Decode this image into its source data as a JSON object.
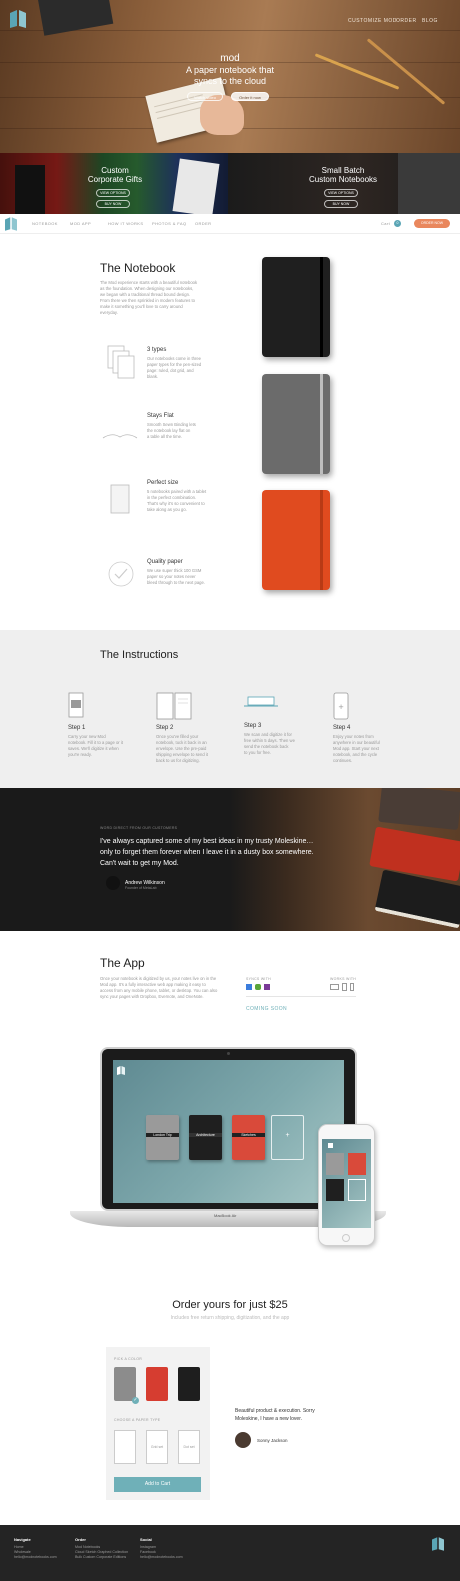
{
  "brand": {
    "logo_color": "#5aa5b5"
  },
  "hero": {
    "nav": [
      "CUSTOMIZE MOD",
      "ORDER",
      "BLOG"
    ],
    "title": "mod",
    "subtitle_line1": "A paper notebook that",
    "subtitle_line2": "syncs to the cloud",
    "watch_label": "Watch video",
    "order_label": "Order it now"
  },
  "promos": [
    {
      "title_line1": "Custom",
      "title_line2": "Corporate Gifts",
      "btn1": "VIEW OPTIONS",
      "btn2": "BUY NOW"
    },
    {
      "title_line1": "Small Batch",
      "title_line2": "Custom Notebooks",
      "btn1": "VIEW OPTIONS",
      "btn2": "BUY NOW"
    }
  ],
  "subnav": {
    "items": [
      "NOTEBOOK",
      "MOD APP",
      "HOW IT WORKS",
      "PHOTOS & FAQ",
      "ORDER"
    ],
    "cart_label": "Cart",
    "cart_count": "0",
    "order_label": "ORDER NOW"
  },
  "notebook": {
    "title": "The Notebook",
    "intro": [
      "The Mod experience starts with a beautiful notebook",
      "as the foundation. When designing our notebooks,",
      "we began with a traditional thread bound design.",
      "From there we then sprinkled in modern features to",
      "make it something you'll love to carry around",
      "everyday."
    ],
    "features": [
      {
        "title": "3 types",
        "desc": [
          "Our notebooks come in three",
          "paper types for the pen-sized",
          "page: ruled, dot grid, and",
          "blank."
        ]
      },
      {
        "title": "Stays Flat",
        "desc": [
          "Smooth Sewn Binding lets",
          "the notebook lay flat on",
          "a table all the time."
        ]
      },
      {
        "title": "Perfect size",
        "desc": [
          "5 notebooks paired with a tablet",
          "in the perfect combination.",
          "That's why it's so convenient to",
          "take along as you go."
        ]
      },
      {
        "title": "Quality paper",
        "desc": [
          "We use super thick 100 GSM",
          "paper so your notes never",
          "bleed through to the next page."
        ]
      }
    ]
  },
  "instructions": {
    "title": "The Instructions",
    "steps": [
      {
        "title": "Step 1",
        "desc": [
          "Carry your new Mod",
          "notebook. Fill it to a page or it",
          "saves. We'll digitize it when",
          "you're ready."
        ]
      },
      {
        "title": "Step 2",
        "desc": [
          "Once you've filled your",
          "notebook, tuck it back in an",
          "envelope. Use the pre-paid",
          "shipping envelope to send it",
          "back to us for digitizing."
        ]
      },
      {
        "title": "Step 3",
        "desc": [
          "We scan and digitize it for",
          "free within 5 days. Then we",
          "send the notebook back",
          "to you for free."
        ]
      },
      {
        "title": "Step 4",
        "desc": [
          "Enjoy your notes from",
          "anywhere in our beautiful",
          "Mod app. Start your next",
          "notebook, and the cycle",
          "continues."
        ]
      }
    ]
  },
  "testimonial": {
    "eyebrow": "WORD DIRECT FROM OUR CUSTOMERS",
    "quote": [
      "I've always captured some of my best ideas in my trusty Moleskine…",
      "only to forget them forever when I leave it in a dusty box somewhere.",
      "Can't wait to get my Mod."
    ],
    "author": "Andrew Wilkinson",
    "role": "Founder of MetaLab"
  },
  "app": {
    "title": "The App",
    "desc": [
      "Once your notebook is digitized by us, your notes live on in the",
      "Mod app. It's a fully interactive web app making it easy to",
      "access from any mobile phone, tablet, or desktop. You can also",
      "sync your pages with Dropbox, Evernote, and OneNote."
    ],
    "syncs_label": "SYNCS WITH",
    "works_label": "WORKS WITH",
    "coming_soon": "COMING SOON",
    "laptop_label": "MacBook Air",
    "screen_notebooks": [
      "London Trip",
      "Architecture",
      "Sketches"
    ]
  },
  "order": {
    "title": "Order yours for just $25",
    "subtitle": "Includes free return shipping, digitization, and the app",
    "color_label": "PICK A COLOR",
    "paper_label": "CHOOSE A PAPER TYPE",
    "paper_options": [
      "",
      "Grid set",
      "Dot set"
    ],
    "add_label": "Add to Cart",
    "review": [
      "Beautiful product & execution. Sorry",
      "Moleskine, I have a new lover."
    ],
    "reviewer": "Sonny Jackson"
  },
  "footer": {
    "cols": [
      {
        "head": "Navigate",
        "links": [
          "Home",
          "Wholesale",
          "hello@modnotebooks.com"
        ]
      },
      {
        "head": "Order",
        "links": [
          "Mod Notebooks",
          "Cloud Sketch Graphed Collection",
          "Bulk Custom Corporate Editions"
        ]
      },
      {
        "head": "Social",
        "links": [
          "Instagram",
          "Facebook",
          "hello@modnotebooks.com"
        ]
      }
    ]
  }
}
